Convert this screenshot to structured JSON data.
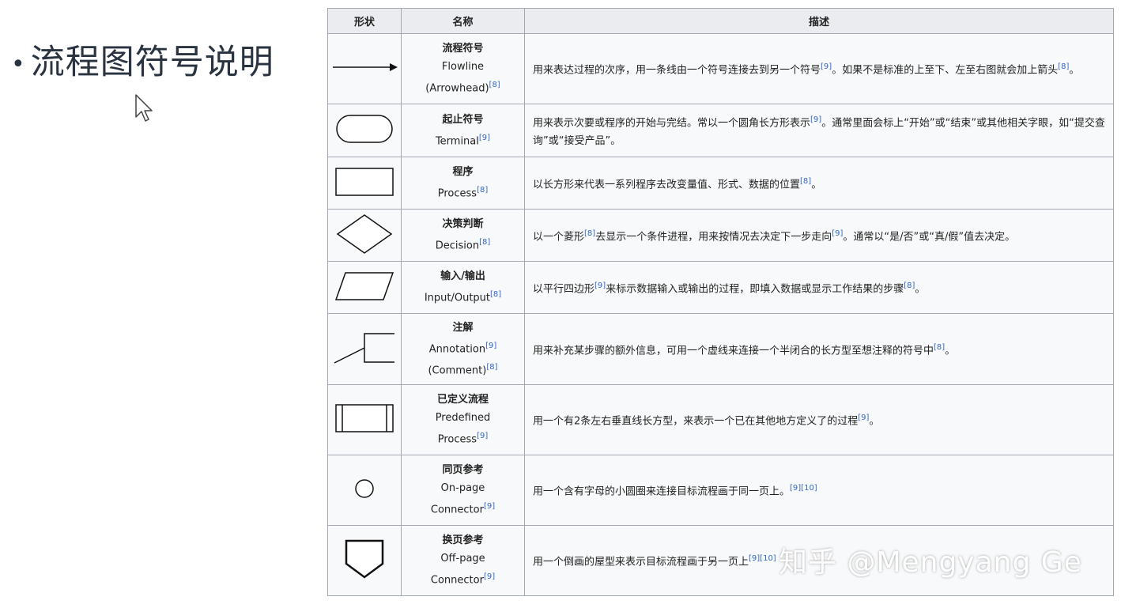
{
  "slide": {
    "title": "流程图符号说明",
    "bullet": "•"
  },
  "table": {
    "headers": [
      "形状",
      "名称",
      "描述"
    ],
    "rows": [
      {
        "shape": "arrow-icon",
        "name_cn": "流程符号",
        "name_en": [
          "Flowline",
          "(Arrowhead)"
        ],
        "name_ref": "[8]",
        "desc": "用来表达过程的次序，用一条线由一个符号连接去到另一个符号",
        "desc_ref": "[9]",
        "desc2": "。如果不是标准的上至下、左至右图就会加上箭头",
        "desc2_ref": "[8]",
        "desc_end": "。"
      },
      {
        "shape": "terminal-icon",
        "name_cn": "起止符号",
        "name_en": [
          "Terminal"
        ],
        "name_ref": "[9]",
        "desc": "用来表示次要或程序的开始与完结。常以一个圆角长方形表示",
        "desc_ref": "[9]",
        "desc2": "。通常里面会标上“开始”或“结束”或其他相关字眼，如“提交查询”或“接受产品”。",
        "desc2_ref": "",
        "desc_end": ""
      },
      {
        "shape": "process-icon",
        "name_cn": "程序",
        "name_en": [
          "Process"
        ],
        "name_ref": "[8]",
        "desc": "以长方形来代表一系列程序去改变量值、形式、数据的位置",
        "desc_ref": "[8]",
        "desc2": "。",
        "desc2_ref": "",
        "desc_end": ""
      },
      {
        "shape": "decision-icon",
        "name_cn": "决策判断",
        "name_en": [
          "Decision"
        ],
        "name_ref": "[8]",
        "desc": "以一个菱形",
        "desc_ref": "[8]",
        "desc2": "去显示一个条件进程，用来按情况去决定下一步走向",
        "desc2_ref": "[9]",
        "desc_end": "。通常以“是/否”或“真/假”值去决定。"
      },
      {
        "shape": "io-icon",
        "name_cn": "输入/输出",
        "name_en": [
          "Input/Output"
        ],
        "name_ref": "[8]",
        "desc": "以平行四边形",
        "desc_ref": "[9]",
        "desc2": "来标示数据输入或输出的过程，即填入数据或显示工作结果的步骤",
        "desc2_ref": "[8]",
        "desc_end": "。"
      },
      {
        "shape": "annotation-icon",
        "name_cn": "注解",
        "name_en": [
          "Annotation",
          "(Comment)"
        ],
        "name_ref_1": "[9]",
        "name_ref": "[8]",
        "desc": "用来补充某步骤的额外信息，可用一个虚线来连接一个半闭合的长方型至想注释的符号中",
        "desc_ref": "[8]",
        "desc2": "。",
        "desc2_ref": "",
        "desc_end": ""
      },
      {
        "shape": "predefined-process-icon",
        "name_cn": "已定义流程",
        "name_en": [
          "Predefined",
          "Process"
        ],
        "name_ref": "[9]",
        "desc": "用一个有2条左右垂直线长方型，来表示一个已在其他地方定义了的过程",
        "desc_ref": "[9]",
        "desc2": "。",
        "desc2_ref": "",
        "desc_end": ""
      },
      {
        "shape": "on-page-connector-icon",
        "name_cn": "同页参考",
        "name_en": [
          "On-page",
          "Connector"
        ],
        "name_ref": "[9]",
        "desc": "用一个含有字母的小圆圈来连接目标流程画于同一页上。",
        "desc_ref": "[9][10]",
        "desc2": "",
        "desc2_ref": "",
        "desc_end": ""
      },
      {
        "shape": "off-page-connector-icon",
        "name_cn": "换页参考",
        "name_en": [
          "Off-page",
          "Connector"
        ],
        "name_ref": "[9]",
        "desc": "用一个倒画的屋型来表示目标流程画于另一页上",
        "desc_ref": "[9][10]",
        "desc2": "",
        "desc2_ref": "",
        "desc_end": ""
      }
    ]
  },
  "watermark": "知乎 @Mengyang Ge"
}
